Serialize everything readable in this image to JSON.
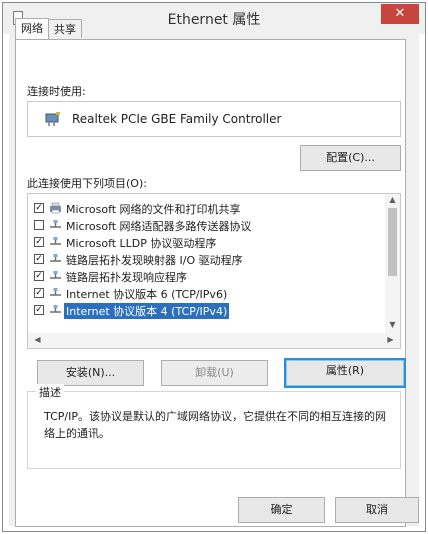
{
  "window": {
    "title": "Ethernet 属性",
    "close_label": "✕"
  },
  "tabs": [
    {
      "label": "网络",
      "active": true
    },
    {
      "label": "共享",
      "active": false
    }
  ],
  "connect_using": {
    "label": "连接时使用:",
    "adapter_name": "Realtek PCIe GBE Family Controller",
    "configure_button": "配置(C)..."
  },
  "items_section": {
    "label": "此连接使用下列项目(O):",
    "items": [
      {
        "checked": true,
        "text": "Microsoft 网络的文件和打印机共享",
        "icon": "printer-share-icon",
        "selected": false
      },
      {
        "checked": false,
        "text": "Microsoft 网络适配器多路传送器协议",
        "icon": "protocol-icon",
        "selected": false
      },
      {
        "checked": true,
        "text": "Microsoft LLDP 协议驱动程序",
        "icon": "protocol-icon",
        "selected": false
      },
      {
        "checked": true,
        "text": "链路层拓扑发现映射器 I/O 驱动程序",
        "icon": "protocol-icon",
        "selected": false
      },
      {
        "checked": true,
        "text": "链路层拓扑发现响应程序",
        "icon": "protocol-icon",
        "selected": false
      },
      {
        "checked": true,
        "text": "Internet 协议版本 6 (TCP/IPv6)",
        "icon": "protocol-icon",
        "selected": false
      },
      {
        "checked": true,
        "text": "Internet 协议版本 4 (TCP/IPv4)",
        "icon": "protocol-icon",
        "selected": true
      }
    ]
  },
  "buttons": {
    "install": "安装(N)...",
    "uninstall": "卸载(U)",
    "properties": "属性(R)",
    "ok": "确定",
    "cancel": "取消"
  },
  "description": {
    "title": "描述",
    "text": "TCP/IP。该协议是默认的广域网络协议，它提供在不同的相互连接的网络上的通讯。"
  },
  "colors": {
    "selection": "#2b6fbd",
    "close_button": "#c7453c",
    "focus_border": "#2a8fd4"
  }
}
